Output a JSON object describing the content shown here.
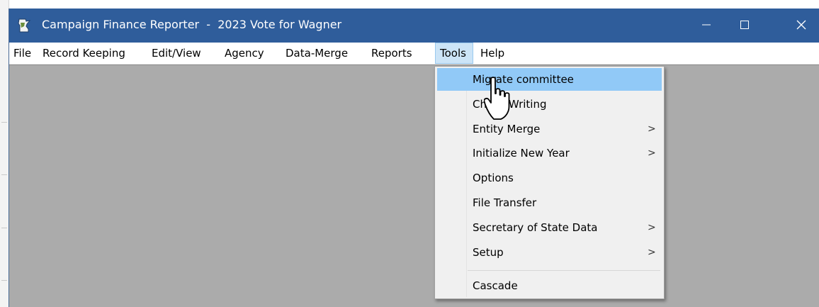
{
  "window": {
    "title": "Campaign Finance Reporter  -  2023 Vote for Wagner",
    "minimize_icon": "minimize-icon",
    "maximize_icon": "maximize-icon",
    "close_icon": "close-icon"
  },
  "menubar": {
    "items": [
      {
        "label": "File"
      },
      {
        "label": "Record Keeping"
      },
      {
        "label": "Edit/View"
      },
      {
        "label": "Agency"
      },
      {
        "label": "Data-Merge"
      },
      {
        "label": "Reports"
      },
      {
        "label": "Tools"
      },
      {
        "label": "Help"
      }
    ],
    "active": "Tools"
  },
  "tools_menu": {
    "items": [
      {
        "label": "Migrate committee",
        "submenu": false,
        "highlighted": true
      },
      {
        "label": "Check Writing",
        "submenu": false
      },
      {
        "label": "Entity Merge",
        "submenu": true
      },
      {
        "label": "Initialize New Year",
        "submenu": true
      },
      {
        "label": "Options",
        "submenu": false
      },
      {
        "label": "File Transfer",
        "submenu": false
      },
      {
        "label": "Secretary of State Data",
        "submenu": true
      },
      {
        "label": "Setup",
        "submenu": true
      },
      {
        "label": "Cascade",
        "submenu": false
      }
    ],
    "submenu_arrow": ">"
  },
  "colors": {
    "titlebar": "#2f5d9b",
    "client_area": "#ababab",
    "highlight": "#91c9f7"
  }
}
